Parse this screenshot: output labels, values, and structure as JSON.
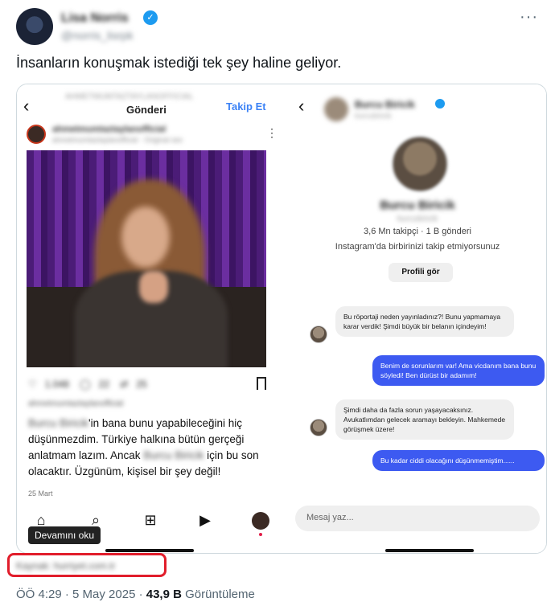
{
  "tweet": {
    "author_name": "Lisa Norris",
    "author_handle": "@norris_lisrpk",
    "text": "İnsanların konuşmak istediği tek şey haline geliyor.",
    "source_label": "Kaynak: hurriyet.com.tr",
    "time": "ÖÖ 4:29 · 5 May 2025 · ",
    "views_count": "43,9 B",
    "views_label": " Görüntüleme"
  },
  "left_screen": {
    "top_user": "AHMETMUMTAZTAYLANOFFICIAL",
    "title": "Gönderi",
    "follow_label": "Takip Et",
    "post_user": "ahmetmumtaztaylanofficial",
    "post_sub": "ahmetmumtaztaylanofficial · Original ses",
    "likes": "1.048",
    "comments": "22",
    "shares": "25",
    "liked_by": "ahmetmumtaztaylanofficial",
    "caption_name_1": "Burcu Biricik",
    "caption_part_1": "'in bana bunu yapabileceğini hiç düşünmezdim. Türkiye halkına bütün gerçeği anlatmam lazım. Ancak ",
    "caption_name_2": "Burcu Biricik",
    "caption_part_2": " için bu son olacaktır. Üzgünüm, kişisel bir şey değil!",
    "date": "25 Mart",
    "tooltip": "Devamını oku"
  },
  "right_screen": {
    "dm_name": "Burcu Biricik",
    "dm_sub": "burcubiricik",
    "profile_name": "Burcu Biricik",
    "profile_handle": "burcubiricik",
    "stats": "3,6 Mn takipçi · 1 B gönderi",
    "note": "Instagram'da birbirinizi takip etmiyorsunuz",
    "profile_button": "Profili gör",
    "messages": [
      {
        "dir": "in",
        "text": "Bu röportaji neden yayınladınız?! Bunu yapmamaya karar verdik! Şimdi büyük bir belanın içindeyim!"
      },
      {
        "dir": "out",
        "text": "Benim de sorunlarım var! Ama vicdanım bana bunu söyledi! Ben dürüst bir adamım!"
      },
      {
        "dir": "in",
        "text": "Şimdi daha da fazla sorun yaşayacaksınız. Avukatlımdan gelecek aramayı bekleyin. Mahkemede görüşmek üzere!"
      },
      {
        "dir": "out",
        "text": "Bu kadar ciddi olacağını düşünmemiştim......"
      }
    ],
    "composer_placeholder": "Mesaj yaz..."
  }
}
